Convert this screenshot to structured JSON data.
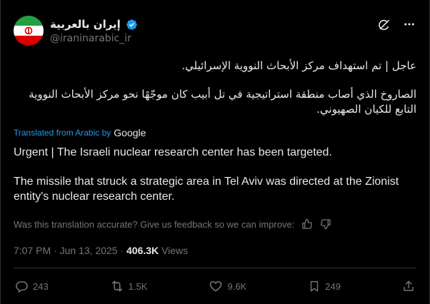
{
  "author": {
    "display_name": "إيران بالعربية",
    "handle": "@iraninarabic_ir"
  },
  "post": {
    "arabic_lines": [
      "عاجل | تم استهداف مركز الأبحاث النووية الإسرائيلي.",
      "الصاروخ الذي أصاب منطقة استراتيجية في تل أبيب كان موجّهًا نحو مركز الأبحاث النووية التابع للكيان الصهيوني."
    ],
    "translated_label": "Translated from Arabic by",
    "translator": "Google",
    "translation_lines": [
      "Urgent | The Israeli nuclear research center has been targeted.",
      "The missile that struck a strategic area in Tel Aviv was directed at the Zionist entity's nuclear research center."
    ],
    "feedback_question": "Was this translation accurate? Give us feedback so we can improve:",
    "time": "7:07 PM",
    "date": "Jun 13, 2025",
    "views_count": "406.3K",
    "views_label": "Views"
  },
  "actions": {
    "replies": "243",
    "reposts": "1.5K",
    "likes": "9.6K",
    "bookmarks": "249"
  },
  "colors": {
    "background": "#000000",
    "text": "#e7e9ea",
    "muted": "#71767b",
    "link": "#1d9bf0",
    "verified": "#1d9bf0"
  }
}
